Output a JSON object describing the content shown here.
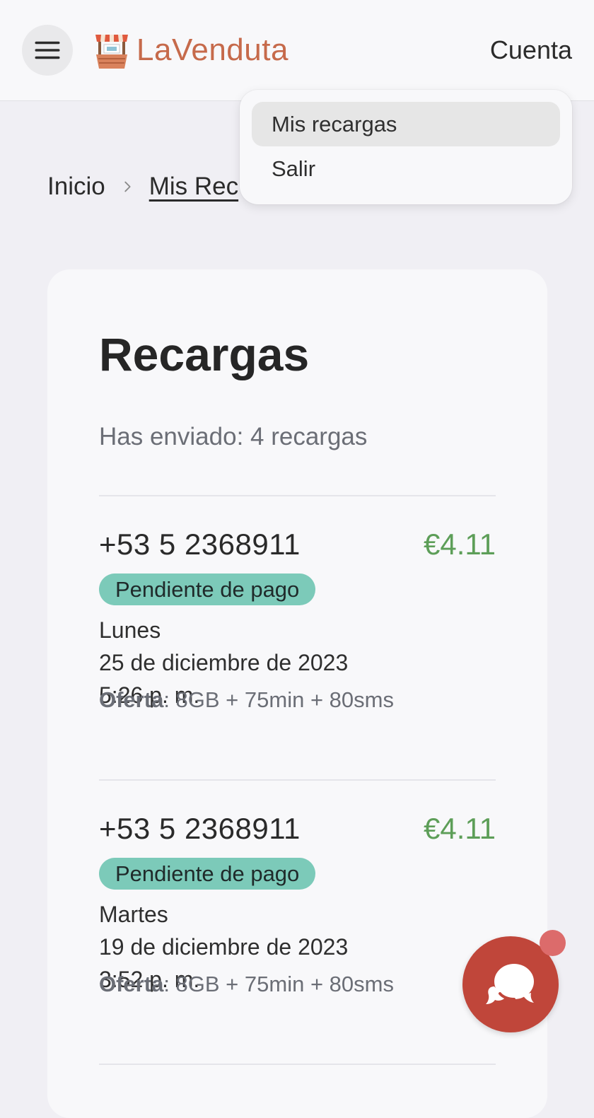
{
  "header": {
    "logo_text": "LaVenduta",
    "account_label": "Cuenta"
  },
  "account_menu": {
    "items": [
      {
        "label": "Mis recargas"
      },
      {
        "label": "Salir"
      }
    ]
  },
  "breadcrumb": {
    "home": "Inicio",
    "current": "Mis Rec"
  },
  "main": {
    "title": "Recargas",
    "sent_summary": "Has enviado: 4 recargas",
    "recharges": [
      {
        "phone": "+53 5 2368911",
        "amount": "€4.11",
        "status": "Pendiente de pago",
        "weekday": "Lunes",
        "date": "25 de diciembre de 2023",
        "time": "5:26 p. m.",
        "offer_label": "Oferta",
        "offer_value": ": 8GB + 75min + 80sms"
      },
      {
        "phone": "+53 5 2368911",
        "amount": "€4.11",
        "status": "Pendiente de pago",
        "weekday": "Martes",
        "date": "19 de diciembre de 2023",
        "time": "3:52 p. m.",
        "offer_label": "Oferta",
        "offer_value": ": 8GB + 75min + 80sms"
      }
    ]
  },
  "icons": {
    "menu": "hamburger-menu-icon",
    "logo": "market-stall-icon",
    "breadcrumb_separator": "chevron-right-icon",
    "chat": "chat-bubbles-icon"
  },
  "colors": {
    "brand": "#c66a4b",
    "amount": "#5d9e58",
    "status_badge": "#7ccab9",
    "chat_button": "#c0463a",
    "notification_dot": "#dc6b6b"
  }
}
